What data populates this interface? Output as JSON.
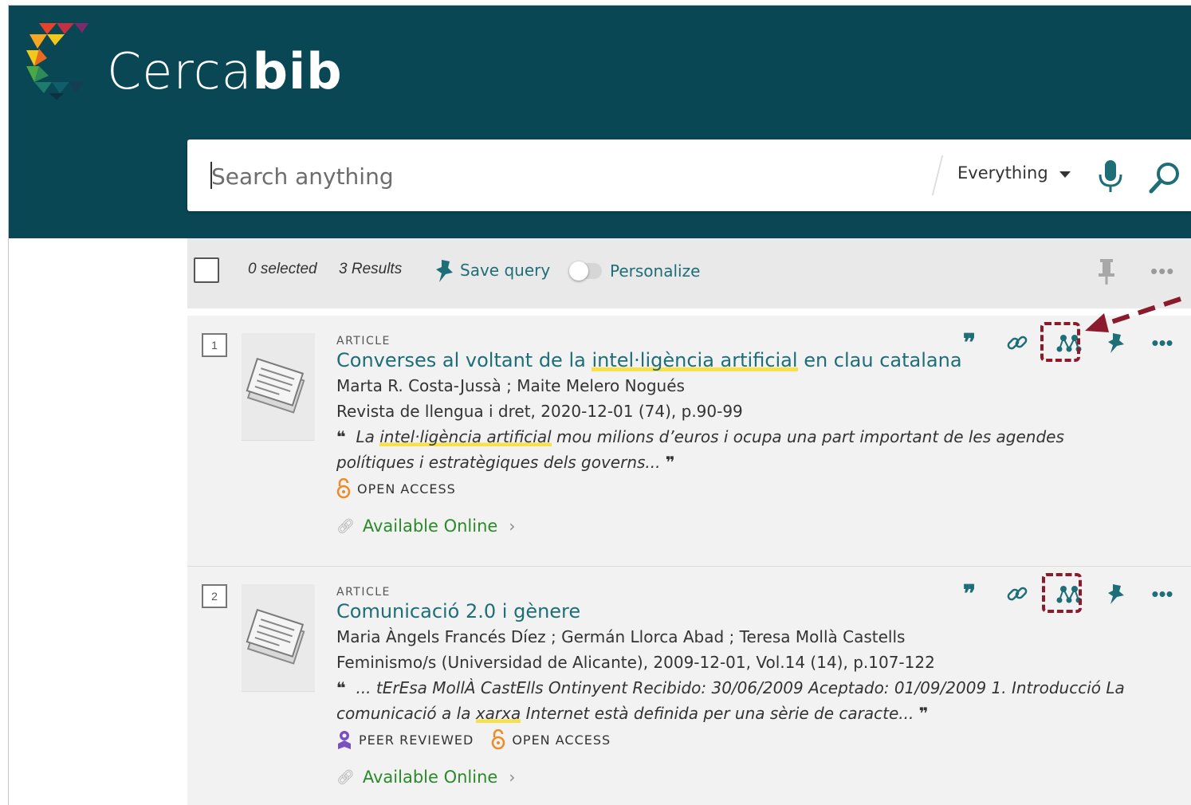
{
  "app": {
    "logo_text_light": "Cerca",
    "logo_text_bold": "bib"
  },
  "search": {
    "placeholder": "Search anything",
    "scope": "Everything"
  },
  "toolbar": {
    "selected": "0 selected",
    "results": "3 Results",
    "save_query": "Save query",
    "personalize": "Personalize",
    "personalize_on": false,
    "more": "•••"
  },
  "results": [
    {
      "index": "1",
      "type": "ARTICLE",
      "title_pre": "Converses al voltant de la ",
      "title_hl": "intel·ligència artificial",
      "title_post": " en clau catalana",
      "authors": "Marta R. Costa-Jussà ; Maite Melero Nogués",
      "source": "Revista de llengua i dret, 2020-12-01 (74), p.90-99",
      "snippet_pre": "La ",
      "snippet_hl": "intel·ligència artificial",
      "snippet_post": " mou milions d’euros i ocupa una part important de les agendes polítiques i estratègiques dels governs...",
      "badges": [
        "OPEN ACCESS"
      ],
      "availability": "Available Online",
      "highlighted_action": "network-icon"
    },
    {
      "index": "2",
      "type": "ARTICLE",
      "title": "Comunicació 2.0 i gènere",
      "authors": "Maria Àngels Francés Díez ; Germán Llorca Abad ; Teresa Mollà Castells",
      "source": "Feminismo/s (Universidad de Alicante), 2009-12-01, Vol.14 (14), p.107-122",
      "snippet_pre": "... tErEsa MollÀ CastElls Ontinyent Recibido: 30/06/2009 Aceptado: 01/09/2009 1. Introducció La comunicació a la ",
      "snippet_hl": "xarxa",
      "snippet_post": " Internet està definida per una sèrie de caracte...",
      "badges": [
        "PEER REVIEWED",
        "OPEN ACCESS"
      ],
      "availability": "Available Online",
      "highlighted_action": "network-icon"
    }
  ],
  "icons": {
    "cite": "cite-quote-icon",
    "link": "permalink-icon",
    "network": "citation-network-icon",
    "pin": "pin-icon",
    "more": "more-actions-icon",
    "mic": "microphone-icon",
    "search": "search-icon",
    "open_access": "open-lock-icon",
    "peer_reviewed": "peer-reviewed-icon"
  },
  "colors": {
    "header_bg": "#094755",
    "accent": "#1e6e78",
    "annotation": "#8b1a2c",
    "highlight": "#f7e04b",
    "open_access": "#f08a24",
    "peer_reviewed": "#7a4fbf",
    "available": "#2a8a2a"
  }
}
